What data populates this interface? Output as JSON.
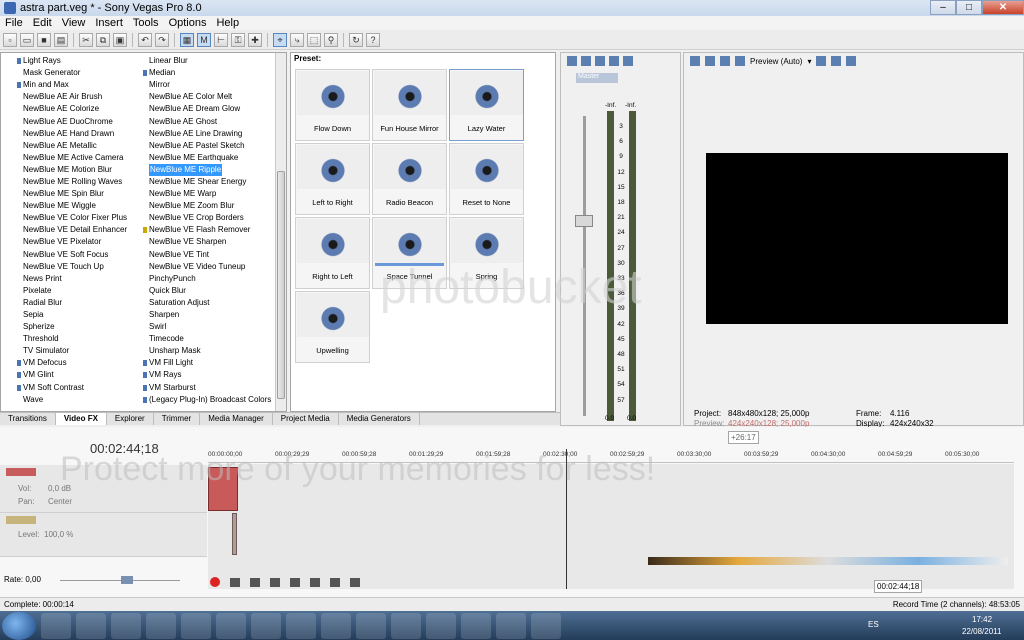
{
  "window": {
    "title": "astra part.veg * - Sony Vegas Pro 8.0"
  },
  "menu": [
    "File",
    "Edit",
    "View",
    "Insert",
    "Tools",
    "Options",
    "Help"
  ],
  "fx_list": {
    "col1": [
      {
        "label": "Light Rays",
        "mark": "b"
      },
      {
        "label": "Mask Generator",
        "mark": ""
      },
      {
        "label": "Min and Max",
        "mark": "b"
      },
      {
        "label": "NewBlue AE Air Brush",
        "mark": ""
      },
      {
        "label": "NewBlue AE Colorize",
        "mark": ""
      },
      {
        "label": "NewBlue AE DuoChrome",
        "mark": ""
      },
      {
        "label": "NewBlue AE Hand Drawn",
        "mark": ""
      },
      {
        "label": "NewBlue AE Metallic",
        "mark": ""
      },
      {
        "label": "NewBlue ME Active Camera",
        "mark": ""
      },
      {
        "label": "NewBlue ME Motion Blur",
        "mark": ""
      },
      {
        "label": "NewBlue ME Rolling Waves",
        "mark": ""
      },
      {
        "label": "NewBlue ME Spin Blur",
        "mark": ""
      },
      {
        "label": "NewBlue ME Wiggle",
        "mark": ""
      },
      {
        "label": "NewBlue VE Color Fixer Plus",
        "mark": ""
      },
      {
        "label": "NewBlue VE Detail Enhancer",
        "mark": ""
      },
      {
        "label": "NewBlue VE Pixelator",
        "mark": ""
      },
      {
        "label": "NewBlue VE Soft Focus",
        "mark": ""
      },
      {
        "label": "NewBlue VE Touch Up",
        "mark": ""
      },
      {
        "label": "News Print",
        "mark": ""
      },
      {
        "label": "Pixelate",
        "mark": ""
      },
      {
        "label": "Radial Blur",
        "mark": ""
      },
      {
        "label": "Sepia",
        "mark": ""
      },
      {
        "label": "Spherize",
        "mark": ""
      },
      {
        "label": "Threshold",
        "mark": ""
      },
      {
        "label": "TV Simulator",
        "mark": ""
      },
      {
        "label": "VM Defocus",
        "mark": "b"
      },
      {
        "label": "VM Glint",
        "mark": "b"
      },
      {
        "label": "VM Soft Contrast",
        "mark": "b"
      },
      {
        "label": "Wave",
        "mark": ""
      }
    ],
    "col2": [
      {
        "label": "Linear Blur",
        "mark": ""
      },
      {
        "label": "Median",
        "mark": "b"
      },
      {
        "label": "Mirror",
        "mark": ""
      },
      {
        "label": "NewBlue AE Color Melt",
        "mark": ""
      },
      {
        "label": "NewBlue AE Dream Glow",
        "mark": ""
      },
      {
        "label": "NewBlue AE Ghost",
        "mark": ""
      },
      {
        "label": "NewBlue AE Line Drawing",
        "mark": ""
      },
      {
        "label": "NewBlue AE Pastel Sketch",
        "mark": ""
      },
      {
        "label": "NewBlue ME Earthquake",
        "mark": ""
      },
      {
        "label": "NewBlue ME Ripple",
        "mark": "",
        "sel": true
      },
      {
        "label": "NewBlue ME Shear Energy",
        "mark": ""
      },
      {
        "label": "NewBlue ME Warp",
        "mark": ""
      },
      {
        "label": "NewBlue ME Zoom Blur",
        "mark": ""
      },
      {
        "label": "NewBlue VE Crop Borders",
        "mark": ""
      },
      {
        "label": "NewBlue VE Flash Remover",
        "mark": "y"
      },
      {
        "label": "NewBlue VE Sharpen",
        "mark": ""
      },
      {
        "label": "NewBlue VE Tint",
        "mark": ""
      },
      {
        "label": "NewBlue VE Video Tuneup",
        "mark": ""
      },
      {
        "label": "PinchyPunch",
        "mark": ""
      },
      {
        "label": "Quick Blur",
        "mark": ""
      },
      {
        "label": "Saturation Adjust",
        "mark": ""
      },
      {
        "label": "Sharpen",
        "mark": ""
      },
      {
        "label": "Swirl",
        "mark": ""
      },
      {
        "label": "Timecode",
        "mark": ""
      },
      {
        "label": "Unsharp Mask",
        "mark": ""
      },
      {
        "label": "VM Fill Light",
        "mark": "b"
      },
      {
        "label": "VM Rays",
        "mark": "b"
      },
      {
        "label": "VM Starburst",
        "mark": "b"
      },
      {
        "label": "(Legacy Plug-In) Broadcast Colors",
        "mark": "b"
      }
    ]
  },
  "presets": {
    "header": "Preset:",
    "items": [
      "Flow Down",
      "Fun House Mirror",
      "Lazy Water",
      "Left to Right",
      "Radio Beacon",
      "Reset to None",
      "Right to Left",
      "Space Tunnel",
      "Spring",
      "Upwelling"
    ]
  },
  "tabs": [
    "Transitions",
    "Video FX",
    "Explorer",
    "Trimmer",
    "Media Manager",
    "Project Media",
    "Media Generators"
  ],
  "mixer": {
    "master": "Master",
    "inf_left": "-Inf.",
    "inf_right": "-Inf.",
    "scale": [
      "3",
      "6",
      "9",
      "12",
      "15",
      "18",
      "21",
      "24",
      "27",
      "30",
      "33",
      "36",
      "39",
      "42",
      "45",
      "48",
      "51",
      "54",
      "57"
    ],
    "level_left": "0.0",
    "level_right": "0.0"
  },
  "preview": {
    "mode": "Preview (Auto)",
    "project_label": "Project:",
    "project_value": "848x480x128; 25,000p",
    "preview_label": "Preview:",
    "preview_value": "424x240x128; 25,000p",
    "frame_label": "Frame:",
    "frame_value": "4.116",
    "display_label": "Display:",
    "display_value": "424x240x32"
  },
  "timeline": {
    "timecode": "00:02:44;18",
    "loop_marker": "+26:17",
    "ruler": [
      "00:00:00;00",
      "00:00:29;29",
      "00:00:59;28",
      "00:01:29;29",
      "00:01:59;28",
      "00:02:30;00",
      "00:02:59;29",
      "00:03:30;00",
      "00:03:59;29",
      "00:04:30;00",
      "00:04:59;29",
      "00:05:30;00"
    ],
    "track1": {
      "vol_label": "Vol:",
      "vol_value": "0,0 dB",
      "pan_label": "Pan:",
      "pan_value": "Center"
    },
    "track2": {
      "level_label": "Level:",
      "level_value": "100,0 %"
    },
    "position": "00:02:44;18"
  },
  "rate": "Rate: 0,00",
  "status": {
    "complete": "Complete: 00:00:14",
    "record_time": "Record Time (2 channels): 48:53:05"
  },
  "taskbar": {
    "lang": "ES",
    "time": "17:42",
    "date": "22/08/2011",
    "icons": [
      "ie-icon",
      "explorer-icon",
      "media-icon",
      "ae-icon",
      "chrome-icon",
      "camera-icon",
      "tool-icon",
      "disc-icon",
      "mail-icon",
      "ps-icon",
      "pdf-icon",
      "game-icon",
      "app-icon",
      "rings-icon",
      "m-icon"
    ]
  },
  "watermarks": {
    "a": "Protect more of your memories for less!",
    "b": "photobucket"
  },
  "colors": {
    "accent": "#3399ff",
    "preview_bg": "#000000",
    "taskbar": "#2b4566"
  }
}
